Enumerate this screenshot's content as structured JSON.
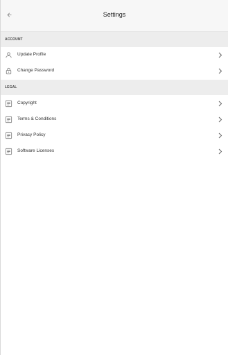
{
  "header": {
    "title": "Settings",
    "back_icon": "arrow-left-icon"
  },
  "sections": [
    {
      "title": "ACCOUNT",
      "items": [
        {
          "label": "Update Profile",
          "icon": "person-icon"
        },
        {
          "label": "Change Password",
          "icon": "lock-icon"
        }
      ]
    },
    {
      "title": "LEGAL",
      "items": [
        {
          "label": "Copyright",
          "icon": "document-icon"
        },
        {
          "label": "Terms & Conditions",
          "icon": "document-icon"
        },
        {
          "label": "Privacy Policy",
          "icon": "document-icon"
        },
        {
          "label": "Software Licenses",
          "icon": "document-icon"
        }
      ]
    }
  ],
  "colors": {
    "app_bar": "#f7f7f7",
    "section_header": "#ededed",
    "icon": "#888888",
    "text": "#333333"
  }
}
